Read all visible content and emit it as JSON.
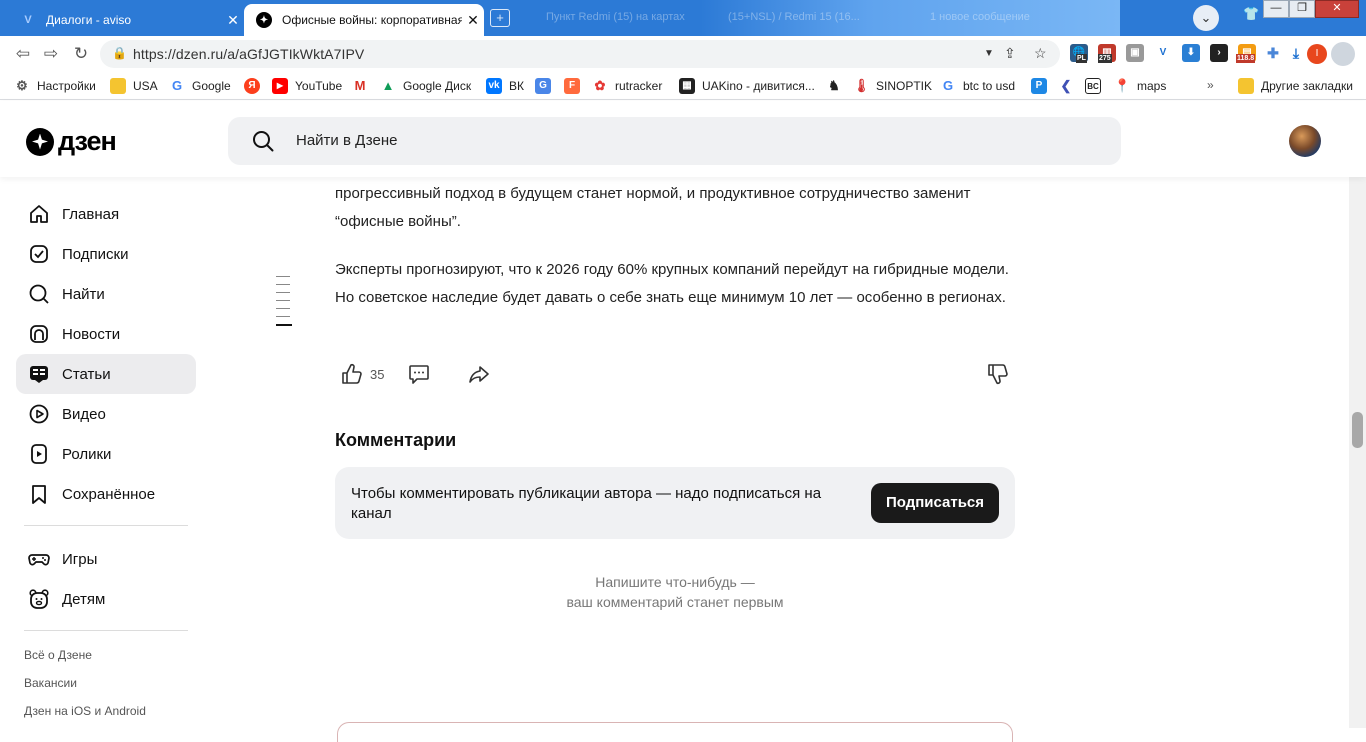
{
  "browser": {
    "tabs": [
      {
        "title": "Диалоги - aviso",
        "favicon": "aviso-v-icon",
        "active": false
      },
      {
        "title": "Офисные войны: корпоративная",
        "favicon": "dzen-icon",
        "active": true
      }
    ],
    "ghost_tabs": [
      "Пункт Redmi (15) на картах",
      "(15+NSL) / Redmi 15 (16...",
      "1 новое сообщение"
    ],
    "profile_glyph": "⌄",
    "window_controls": {
      "minimize": "—",
      "maximize": "❐",
      "close": "✕"
    },
    "address": {
      "url": "https://dzen.ru/a/aGfJGTIkWktA7IPV"
    },
    "extension_badges": {
      "pl": "PL",
      "count": "275",
      "price": "118.8",
      "account": "I"
    },
    "bookmarks": [
      {
        "label": "Настройки",
        "icon": "gear-icon"
      },
      {
        "label": "USA",
        "icon": "folder-icon"
      },
      {
        "label": "Google",
        "icon": "google-icon"
      },
      {
        "label": "",
        "icon": "yandex-icon"
      },
      {
        "label": "YouTube",
        "icon": "youtube-icon"
      },
      {
        "label": "",
        "icon": "gmail-icon"
      },
      {
        "label": "Google Диск",
        "icon": "google-drive-icon"
      },
      {
        "label": "ВК",
        "icon": "vk-icon"
      },
      {
        "label": "",
        "icon": "translate-icon"
      },
      {
        "label": "",
        "icon": "f-icon"
      },
      {
        "label": "rutracker",
        "icon": "rutracker-icon"
      },
      {
        "label": "UAKino - дивитися...",
        "icon": "uakino-icon"
      },
      {
        "label": "",
        "icon": "chess-icon"
      },
      {
        "label": "SINOPTIK",
        "icon": "thermometer-icon"
      },
      {
        "label": "btc to usd",
        "icon": "google-icon"
      },
      {
        "label": "",
        "icon": "p-icon"
      },
      {
        "label": "",
        "icon": "dev-icon"
      },
      {
        "label": "",
        "icon": "bc-icon"
      },
      {
        "label": "maps",
        "icon": "maps-icon"
      }
    ],
    "bookmarks_overflow": "»",
    "other_bookmarks": "Другие закладки"
  },
  "header": {
    "logo_text": "дзен",
    "search_placeholder": "Найти в Дзене"
  },
  "sidebar": {
    "items": [
      {
        "label": "Главная",
        "icon": "home-icon"
      },
      {
        "label": "Подписки",
        "icon": "subscriptions-icon"
      },
      {
        "label": "Найти",
        "icon": "search-icon"
      },
      {
        "label": "Новости",
        "icon": "news-icon"
      },
      {
        "label": "Статьи",
        "icon": "articles-icon",
        "active": true
      },
      {
        "label": "Видео",
        "icon": "video-icon"
      },
      {
        "label": "Ролики",
        "icon": "clips-icon"
      },
      {
        "label": "Сохранённое",
        "icon": "bookmark-icon"
      },
      {
        "label": "Игры",
        "icon": "gamepad-icon"
      },
      {
        "label": "Детям",
        "icon": "kids-icon"
      }
    ],
    "footer_links": [
      "Всё о Дзене",
      "Вакансии",
      "Дзен на iOS и Android"
    ]
  },
  "article": {
    "paragraph_1": "прогрессивный подход в будущем станет нормой, и продуктивное сотрудничество заменит “офисные войны”.",
    "paragraph_2": "Эксперты прогнозируют, что к 2026 году 60% крупных компаний перейдут на гибридные модели. Но советское наследие будет давать о себе знать еще минимум 10 лет — особенно в регионах.",
    "likes": "35"
  },
  "comments": {
    "title": "Комментарии",
    "subscribe_prompt": "Чтобы комментировать публикации автора — надо подписаться на канал",
    "subscribe_button": "Подписаться",
    "empty_line_1": "Напишите что-нибудь —",
    "empty_line_2": "ваш комментарий станет первым"
  },
  "colors": {
    "tabstrip": "#2c7ad6",
    "active_nav": "#ececee",
    "button_dark": "#1a1a1a",
    "panel": "#f0f1f3"
  }
}
